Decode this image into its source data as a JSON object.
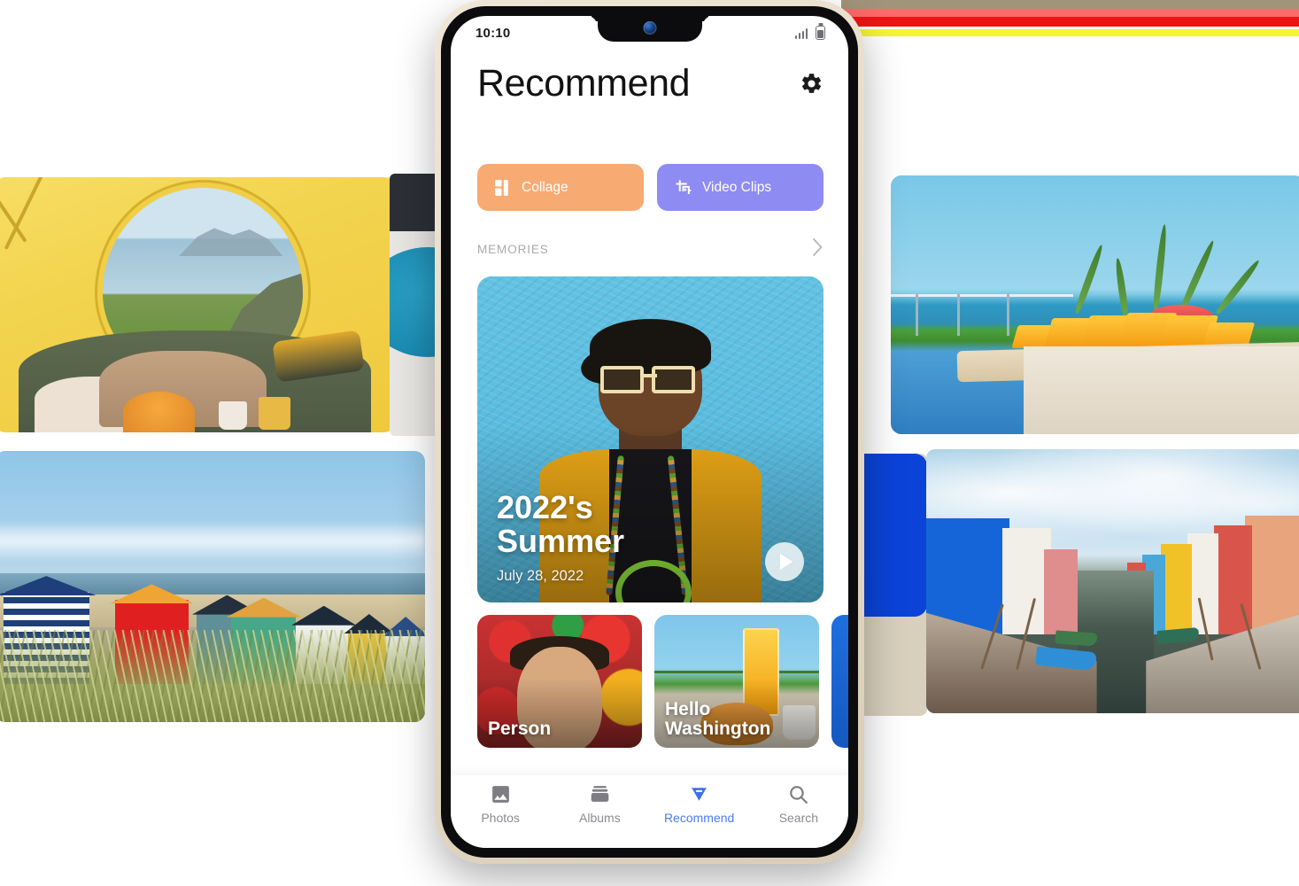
{
  "phone": {
    "status_bar": {
      "clock": "10:10",
      "signal_icon": "signal-bars-icon",
      "battery_icon": "battery-icon"
    },
    "header": {
      "title": "Recommend",
      "settings_icon": "gear-icon"
    },
    "actions": [
      {
        "id": "collage",
        "label": "Collage",
        "icon": "collage-grid-icon",
        "color": "#f7aa72"
      },
      {
        "id": "video_clips",
        "label": "Video Clips",
        "icon": "video-crop-icon",
        "color": "#8e8bf2"
      }
    ],
    "memories": {
      "section_label": "MEMORIES",
      "chevron_icon": "chevron-right-icon",
      "hero": {
        "title_line1": "2022's",
        "title_line2": "Summer",
        "date": "July 28, 2022",
        "play_icon": "play-icon",
        "image_description": "Person in black cap and cream sunglasses wearing a yellow cardigan in front of a turquoise wall"
      },
      "cards": [
        {
          "id": "person",
          "label": "Person",
          "image_description": "Man smiling among colorful balloons"
        },
        {
          "id": "hello_washington",
          "label_line1": "Hello",
          "label_line2": "Washington",
          "image_description": "Croissant and orange juice on a balcony table"
        },
        {
          "id": "partial",
          "label": "",
          "image_description": "Partially visible blue card"
        }
      ]
    },
    "bottom_nav": [
      {
        "id": "photos",
        "label": "Photos",
        "icon": "photo-icon",
        "active": false
      },
      {
        "id": "albums",
        "label": "Albums",
        "icon": "albums-icon",
        "active": false
      },
      {
        "id": "recommend",
        "label": "Recommend",
        "icon": "diamond-icon",
        "active": true
      },
      {
        "id": "search",
        "label": "Search",
        "icon": "search-icon",
        "active": false
      }
    ],
    "accent_color": "#4a7df0"
  },
  "backdrop_photos": [
    {
      "id": "tent",
      "position": "top-left",
      "description": "View from inside a yellow camping tent looking out at the sea, with a pie and mug on a blanket"
    },
    {
      "id": "huts",
      "position": "bottom-left",
      "description": "Row of colorful wooden beach huts behind dune grass"
    },
    {
      "id": "fruit",
      "position": "top-right",
      "description": "Sliced mango and watermelon on a wooden board beside a pool overlooking the sea"
    },
    {
      "id": "canal",
      "position": "bottom-right",
      "description": "Burano canal lined with brightly painted houses and moored boats"
    },
    {
      "id": "tealdisc",
      "position": "behind-phone-left",
      "description": "Partially hidden photo of a teal disc"
    },
    {
      "id": "bluewall",
      "position": "behind-phone-right",
      "description": "Partially hidden photo of a blue building wall"
    }
  ],
  "color_strips": [
    {
      "id": "tan",
      "color": "#a2947a"
    },
    {
      "id": "rose",
      "color": "#fd6a6a"
    },
    {
      "id": "red",
      "color": "#ee1414"
    },
    {
      "id": "yellow",
      "color": "#f6f432"
    }
  ]
}
